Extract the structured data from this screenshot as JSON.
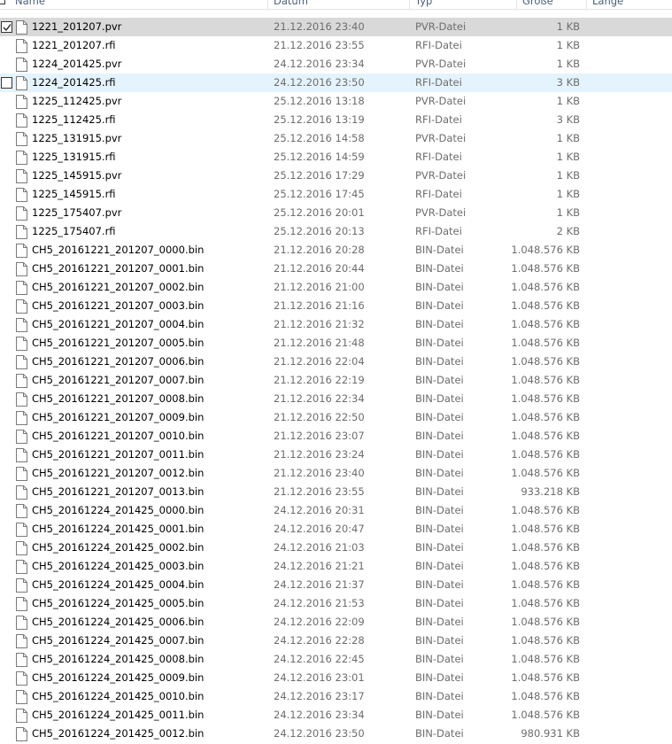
{
  "columns": {
    "name": "Name",
    "date": "Datum",
    "type": "Typ",
    "size": "Größe",
    "length": "Länge"
  },
  "files": [
    {
      "name": "1221_201207.pvr",
      "date": "21.12.2016 23:40",
      "type": "PVR-Datei",
      "size": "1 KB",
      "state": "selected",
      "checked": true
    },
    {
      "name": "1221_201207.rfi",
      "date": "21.12.2016 23:55",
      "type": "RFI-Datei",
      "size": "1 KB"
    },
    {
      "name": "1224_201425.pvr",
      "date": "24.12.2016 23:34",
      "type": "PVR-Datei",
      "size": "1 KB"
    },
    {
      "name": "1224_201425.rfi",
      "date": "24.12.2016 23:50",
      "type": "RFI-Datei",
      "size": "3 KB",
      "state": "hover",
      "checked": false
    },
    {
      "name": "1225_112425.pvr",
      "date": "25.12.2016 13:18",
      "type": "PVR-Datei",
      "size": "1 KB"
    },
    {
      "name": "1225_112425.rfi",
      "date": "25.12.2016 13:19",
      "type": "RFI-Datei",
      "size": "3 KB"
    },
    {
      "name": "1225_131915.pvr",
      "date": "25.12.2016 14:58",
      "type": "PVR-Datei",
      "size": "1 KB"
    },
    {
      "name": "1225_131915.rfi",
      "date": "25.12.2016 14:59",
      "type": "RFI-Datei",
      "size": "1 KB"
    },
    {
      "name": "1225_145915.pvr",
      "date": "25.12.2016 17:29",
      "type": "PVR-Datei",
      "size": "1 KB"
    },
    {
      "name": "1225_145915.rfi",
      "date": "25.12.2016 17:45",
      "type": "RFI-Datei",
      "size": "1 KB"
    },
    {
      "name": "1225_175407.pvr",
      "date": "25.12.2016 20:01",
      "type": "PVR-Datei",
      "size": "1 KB"
    },
    {
      "name": "1225_175407.rfi",
      "date": "25.12.2016 20:13",
      "type": "RFI-Datei",
      "size": "2 KB"
    },
    {
      "name": "CH5_20161221_201207_0000.bin",
      "date": "21.12.2016 20:28",
      "type": "BIN-Datei",
      "size": "1.048.576 KB"
    },
    {
      "name": "CH5_20161221_201207_0001.bin",
      "date": "21.12.2016 20:44",
      "type": "BIN-Datei",
      "size": "1.048.576 KB"
    },
    {
      "name": "CH5_20161221_201207_0002.bin",
      "date": "21.12.2016 21:00",
      "type": "BIN-Datei",
      "size": "1.048.576 KB"
    },
    {
      "name": "CH5_20161221_201207_0003.bin",
      "date": "21.12.2016 21:16",
      "type": "BIN-Datei",
      "size": "1.048.576 KB"
    },
    {
      "name": "CH5_20161221_201207_0004.bin",
      "date": "21.12.2016 21:32",
      "type": "BIN-Datei",
      "size": "1.048.576 KB"
    },
    {
      "name": "CH5_20161221_201207_0005.bin",
      "date": "21.12.2016 21:48",
      "type": "BIN-Datei",
      "size": "1.048.576 KB"
    },
    {
      "name": "CH5_20161221_201207_0006.bin",
      "date": "21.12.2016 22:04",
      "type": "BIN-Datei",
      "size": "1.048.576 KB"
    },
    {
      "name": "CH5_20161221_201207_0007.bin",
      "date": "21.12.2016 22:19",
      "type": "BIN-Datei",
      "size": "1.048.576 KB"
    },
    {
      "name": "CH5_20161221_201207_0008.bin",
      "date": "21.12.2016 22:34",
      "type": "BIN-Datei",
      "size": "1.048.576 KB"
    },
    {
      "name": "CH5_20161221_201207_0009.bin",
      "date": "21.12.2016 22:50",
      "type": "BIN-Datei",
      "size": "1.048.576 KB"
    },
    {
      "name": "CH5_20161221_201207_0010.bin",
      "date": "21.12.2016 23:07",
      "type": "BIN-Datei",
      "size": "1.048.576 KB"
    },
    {
      "name": "CH5_20161221_201207_0011.bin",
      "date": "21.12.2016 23:24",
      "type": "BIN-Datei",
      "size": "1.048.576 KB"
    },
    {
      "name": "CH5_20161221_201207_0012.bin",
      "date": "21.12.2016 23:40",
      "type": "BIN-Datei",
      "size": "1.048.576 KB"
    },
    {
      "name": "CH5_20161221_201207_0013.bin",
      "date": "21.12.2016 23:55",
      "type": "BIN-Datei",
      "size": "933.218 KB"
    },
    {
      "name": "CH5_20161224_201425_0000.bin",
      "date": "24.12.2016 20:31",
      "type": "BIN-Datei",
      "size": "1.048.576 KB"
    },
    {
      "name": "CH5_20161224_201425_0001.bin",
      "date": "24.12.2016 20:47",
      "type": "BIN-Datei",
      "size": "1.048.576 KB"
    },
    {
      "name": "CH5_20161224_201425_0002.bin",
      "date": "24.12.2016 21:03",
      "type": "BIN-Datei",
      "size": "1.048.576 KB"
    },
    {
      "name": "CH5_20161224_201425_0003.bin",
      "date": "24.12.2016 21:21",
      "type": "BIN-Datei",
      "size": "1.048.576 KB"
    },
    {
      "name": "CH5_20161224_201425_0004.bin",
      "date": "24.12.2016 21:37",
      "type": "BIN-Datei",
      "size": "1.048.576 KB"
    },
    {
      "name": "CH5_20161224_201425_0005.bin",
      "date": "24.12.2016 21:53",
      "type": "BIN-Datei",
      "size": "1.048.576 KB"
    },
    {
      "name": "CH5_20161224_201425_0006.bin",
      "date": "24.12.2016 22:09",
      "type": "BIN-Datei",
      "size": "1.048.576 KB"
    },
    {
      "name": "CH5_20161224_201425_0007.bin",
      "date": "24.12.2016 22:28",
      "type": "BIN-Datei",
      "size": "1.048.576 KB"
    },
    {
      "name": "CH5_20161224_201425_0008.bin",
      "date": "24.12.2016 22:45",
      "type": "BIN-Datei",
      "size": "1.048.576 KB"
    },
    {
      "name": "CH5_20161224_201425_0009.bin",
      "date": "24.12.2016 23:01",
      "type": "BIN-Datei",
      "size": "1.048.576 KB"
    },
    {
      "name": "CH5_20161224_201425_0010.bin",
      "date": "24.12.2016 23:17",
      "type": "BIN-Datei",
      "size": "1.048.576 KB"
    },
    {
      "name": "CH5_20161224_201425_0011.bin",
      "date": "24.12.2016 23:34",
      "type": "BIN-Datei",
      "size": "1.048.576 KB"
    },
    {
      "name": "CH5_20161224_201425_0012.bin",
      "date": "24.12.2016 23:50",
      "type": "BIN-Datei",
      "size": "980.931 KB"
    }
  ],
  "icon": "file-icon",
  "colors": {
    "selected": "#d9d9d9",
    "hover": "#e5f3ff",
    "header_text": "#4c607a",
    "meta_text": "#6d6d6d"
  }
}
